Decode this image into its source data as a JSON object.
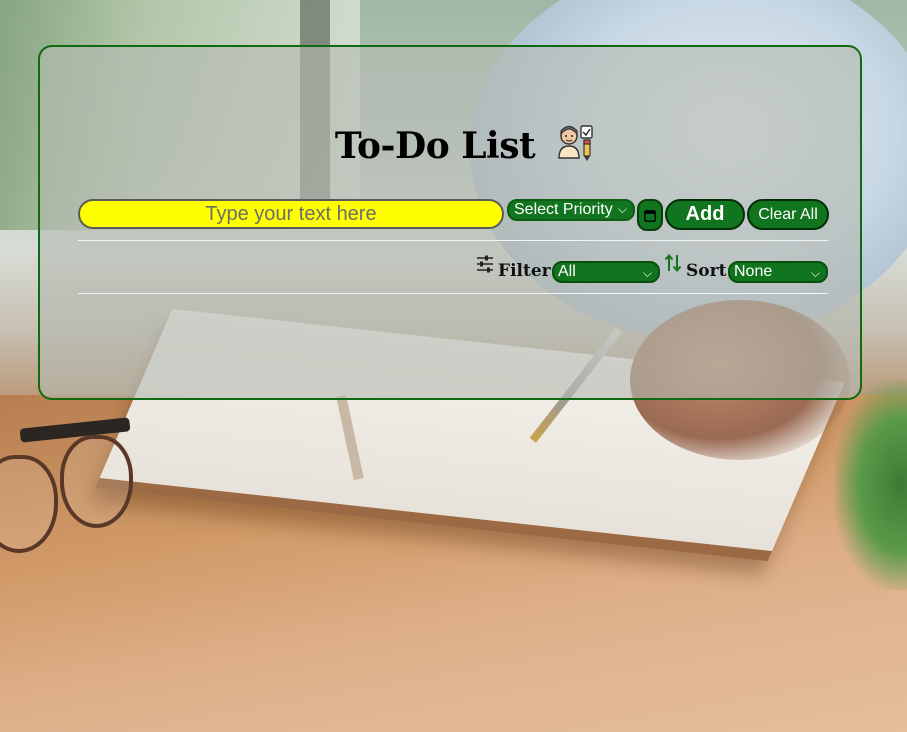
{
  "app": {
    "title": "To-Do List",
    "title_icon": "person-checklist-icon"
  },
  "input": {
    "placeholder": "Type your text here",
    "value": ""
  },
  "priority": {
    "selected": "Select Priority"
  },
  "buttons": {
    "date_icon": "calendar-icon",
    "add_label": "Add",
    "clear_label": "Clear All"
  },
  "filter": {
    "icon": "sliders-icon",
    "label": "Filter",
    "selected": "All"
  },
  "sort": {
    "icon": "sort-arrows-icon",
    "label": "Sort",
    "selected": "None"
  },
  "colors": {
    "accent": "#10751e",
    "input_bg": "#ffff00",
    "card_border": "#0f6a12"
  }
}
